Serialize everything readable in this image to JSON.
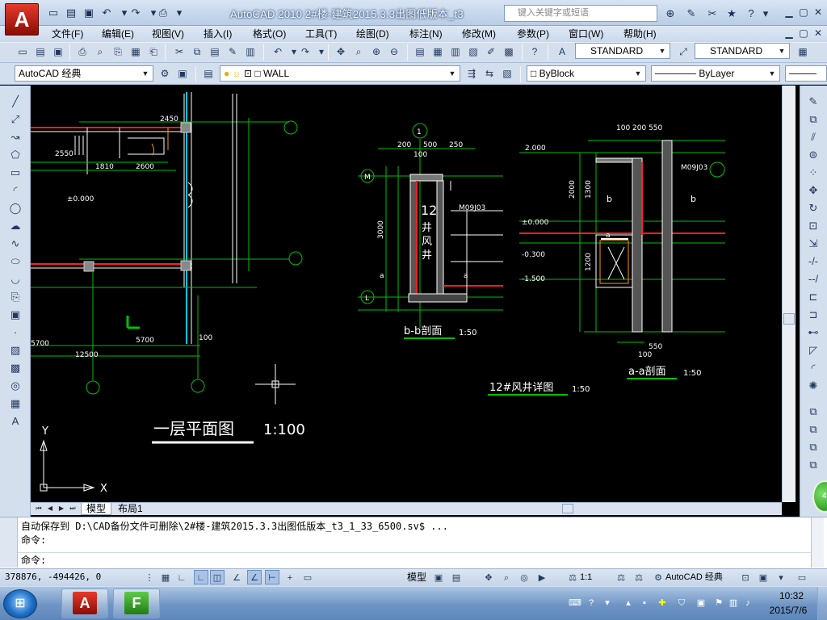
{
  "app": {
    "logo_letter": "A",
    "window_title": "AutoCAD 2010    2#楼-建筑2015.3.3出图低版本_t3",
    "search_placeholder": "键入关键字或短语"
  },
  "menu": [
    "文件(F)",
    "编辑(E)",
    "视图(V)",
    "插入(I)",
    "格式(O)",
    "工具(T)",
    "绘图(D)",
    "标注(N)",
    "修改(M)",
    "参数(P)",
    "窗口(W)",
    "帮助(H)"
  ],
  "toolbar": {
    "text_style": "STANDARD",
    "dim_style": "STANDARD",
    "workspace": "AutoCAD 经典",
    "layer": "WALL",
    "color": "ByBlock",
    "linetype": "ByLayer"
  },
  "drawing": {
    "plan_title": "一层平面图",
    "plan_scale": "1:100",
    "section_bb_title": "b-b剖面",
    "section_bb_scale": "1:50",
    "section_aa_title": "a-a剖面",
    "section_aa_scale": "1:50",
    "shaft_detail_title": "12#风井详图",
    "shaft_detail_scale": "1:50",
    "ucs_x": "X",
    "ucs_y": "Y",
    "level_pos": "±0.000",
    "level_neg300": "-0.300",
    "level_neg1500": "-1.500",
    "level_2000": "2.000",
    "dims": {
      "d2450": "2450",
      "d2550": "2550",
      "d1810": "1810",
      "d2600": "2600",
      "d5700": "5700",
      "d5700b": "5700",
      "d12500": "12500",
      "d200": "200",
      "d500": "500",
      "d250": "250",
      "d100": "100",
      "d3000": "3000",
      "d2000": "2000",
      "d1300": "1300",
      "d1200": "1200",
      "d550": "550",
      "d200_550": "100 200  550"
    },
    "axis_labels": [
      "1",
      "M",
      "L",
      "1"
    ],
    "shaft_text": "12\n井\n风\n井",
    "rail_note": "M09J03"
  },
  "layout_tabs": [
    "模型",
    "布局1"
  ],
  "command": {
    "line1": "自动保存到 D:\\CAD备份文件可删除\\2#楼-建筑2015.3.3出图低版本_t3_1_33_6500.sv$ ...",
    "line2": "命令:",
    "prompt": "命令:"
  },
  "status": {
    "coords": "378876, -494426, 0",
    "model_label": "模型",
    "annotation_scale": "1:1",
    "workspace_label": "AutoCAD 经典"
  },
  "taskbar": {
    "time": "10:32",
    "date": "2015/7/6"
  },
  "colors": {
    "accent_green": "#00c000",
    "wall_red": "#ff2020",
    "cad_white": "#ffffff",
    "cad_cyan": "#00c8ff"
  }
}
